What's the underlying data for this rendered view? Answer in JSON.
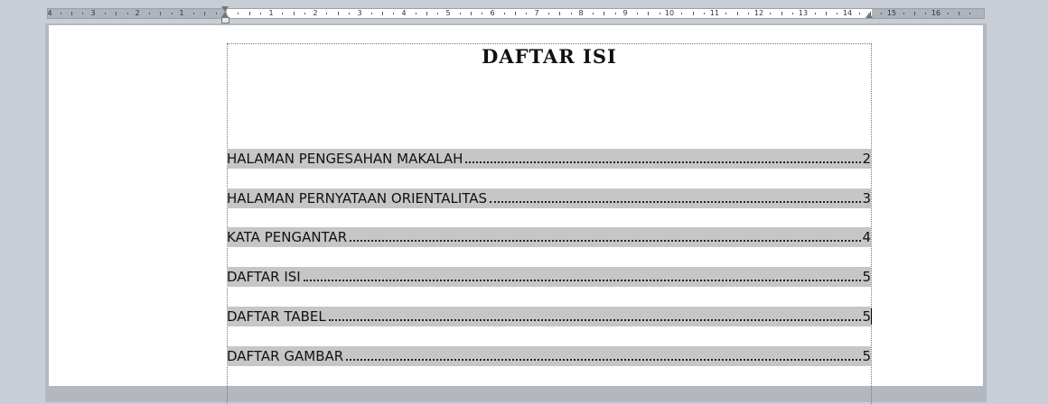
{
  "ruler": {
    "numbers_left": [
      "4",
      "3",
      "2",
      "1"
    ],
    "numbers_right": [
      "1",
      "2",
      "3",
      "4",
      "5",
      "6",
      "7",
      "8",
      "9",
      "10",
      "11",
      "12",
      "13",
      "14",
      "15",
      "16"
    ]
  },
  "document": {
    "title": "DAFTAR ISI",
    "toc": [
      {
        "label": "HALAMAN PENGESAHAN MAKALAH",
        "page": "2"
      },
      {
        "label": "HALAMAN PERNYATAAN ORIENTALITAS",
        "page": "3"
      },
      {
        "label": "KATA PENGANTAR",
        "page": "4"
      },
      {
        "label": "DAFTAR ISI",
        "page": "5"
      },
      {
        "label": "DAFTAR TABEL",
        "page": "5"
      },
      {
        "label": "DAFTAR GAMBAR",
        "page": "5"
      }
    ]
  },
  "colors": {
    "field_shading": "#c6c6c6",
    "workspace": "#c9ced6"
  }
}
